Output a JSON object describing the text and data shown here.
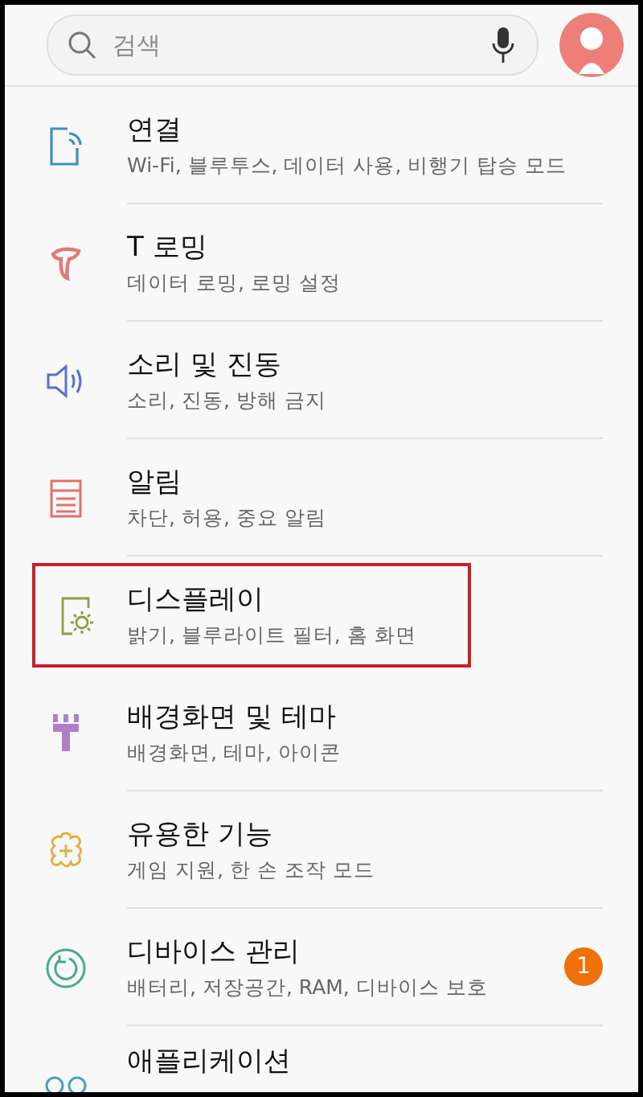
{
  "search": {
    "placeholder": "검색"
  },
  "items": [
    {
      "kind": "connection",
      "color": "#3f8fbf",
      "title": "연결",
      "subtitle": "Wi-Fi, 블루투스, 데이터 사용, 비행기 탑승 모드",
      "highlighted": false
    },
    {
      "kind": "roaming",
      "color": "#e07a7a",
      "title": "T 로밍",
      "subtitle": "데이터 로밍, 로밍 설정",
      "highlighted": false
    },
    {
      "kind": "sound",
      "color": "#5a6fd0",
      "title": "소리 및 진동",
      "subtitle": "소리, 진동, 방해 금지",
      "highlighted": false
    },
    {
      "kind": "notification",
      "color": "#e0726a",
      "title": "알림",
      "subtitle": "차단, 허용, 중요 알림",
      "highlighted": false
    },
    {
      "kind": "display",
      "color": "#8aa040",
      "title": "디스플레이",
      "subtitle": "밝기, 블루라이트 필터, 홈 화면",
      "highlighted": true
    },
    {
      "kind": "wallpaper",
      "color": "#b07ec8",
      "title": "배경화면 및 테마",
      "subtitle": "배경화면, 테마, 아이콘",
      "highlighted": false
    },
    {
      "kind": "advanced",
      "color": "#e0b040",
      "title": "유용한 기능",
      "subtitle": "게임 지원, 한 손 조작 모드",
      "highlighted": false
    },
    {
      "kind": "device",
      "color": "#4aaa8a",
      "title": "디바이스 관리",
      "subtitle": "배터리, 저장공간, RAM, 디바이스 보호",
      "highlighted": false,
      "badge": "1"
    },
    {
      "kind": "apps",
      "color": "#4aa0c8",
      "title": "애플리케이션",
      "highlighted": false
    }
  ]
}
